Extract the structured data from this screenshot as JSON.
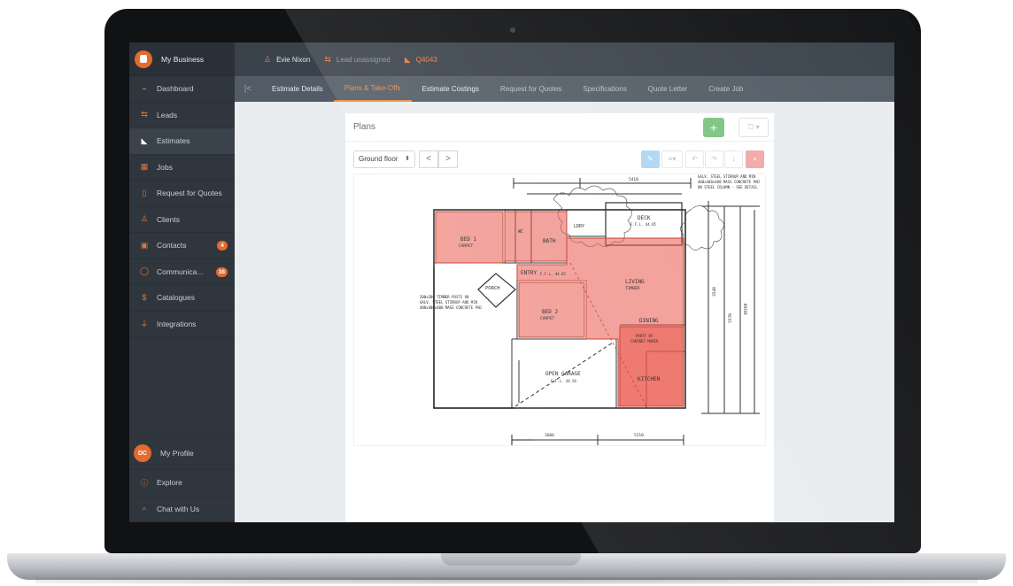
{
  "business": {
    "name": "My Business"
  },
  "sidebar": {
    "items": [
      {
        "label": "Dashboard",
        "icon": "chart-icon"
      },
      {
        "label": "Leads",
        "icon": "arrows-icon"
      },
      {
        "label": "Estimates",
        "icon": "ruler-icon",
        "active": true
      },
      {
        "label": "Jobs",
        "icon": "calendar-icon"
      },
      {
        "label": "Request for Quotes",
        "icon": "document-icon"
      },
      {
        "label": "Clients",
        "icon": "user-icon"
      },
      {
        "label": "Contacts",
        "icon": "address-book-icon",
        "badge": "4"
      },
      {
        "label": "Communica...",
        "icon": "chat-bubble-icon",
        "badge": "38"
      },
      {
        "label": "Catalogues",
        "icon": "dollar-circle-icon"
      },
      {
        "label": "Integrations",
        "icon": "plug-icon"
      }
    ],
    "profile": {
      "initials": "DC",
      "label": "My Profile"
    },
    "explore": "Explore",
    "chat": "Chat with Us"
  },
  "topbar": {
    "client": "Evie Nixon",
    "lead_status": "Lead unassigned",
    "quote_id": "Q4043"
  },
  "tabs": [
    {
      "label": "Estimate Details"
    },
    {
      "label": "Plans & Take-Offs",
      "active": true
    },
    {
      "label": "Estimate Costings"
    },
    {
      "label": "Request for Quotes"
    },
    {
      "label": "Specifications"
    },
    {
      "label": "Quote Letter"
    },
    {
      "label": "Create Job"
    }
  ],
  "plans": {
    "title": "Plans",
    "add_label": "+",
    "menu_label": "☐ ▾",
    "floor_selected": "Ground floor",
    "prev": "<",
    "next": ">"
  },
  "floorplan_labels": {
    "bed1": "BED 1",
    "bed1_floor": "CARPET",
    "wc": "WC",
    "bath": "BATH",
    "ldry": "LDRY",
    "deck": "DECK",
    "deck_ffl": "F.F.L. 44.85",
    "entry": "ENTRY",
    "entry_ffl": "F.F.L. 44.85",
    "porch": "PORCH",
    "living": "LIVING",
    "living_floor": "TIMBER",
    "bed2": "BED 2",
    "bed2_floor": "CARPET",
    "dining": "DINING",
    "partition": "PARTY BY",
    "partition2": "CABINET MAKER",
    "garage": "OPEN GARAGE",
    "garage_ffl": "F.F.L. 44.56",
    "kitchen": "KITCHEN",
    "note_posts": "200x200 TIMBER POSTS ON",
    "note_posts2": "GALV. STEEL STIRRUP AND MIN",
    "note_posts3": "400x400x400 MASS CONCRETE PAD",
    "note_deck": "GALV. STEEL STIRRUP AND MIN",
    "note_deck2": "400x400x400 MASS CONCRETE PAD",
    "note_deck3": "ON STEEL COLUMN - SEE DETAIL",
    "dim_bottom_left": "3600",
    "dim_bottom_right": "5210",
    "dim_top": "5410",
    "dim_right_1": "3540",
    "dim_right_2": "5570",
    "dim_right_3": "10260"
  },
  "colors": {
    "accent": "#e46a2e",
    "sidebar_bg": "#2f363e",
    "takeoff_fill": "#e8493c",
    "add_button": "#7cc47f"
  }
}
